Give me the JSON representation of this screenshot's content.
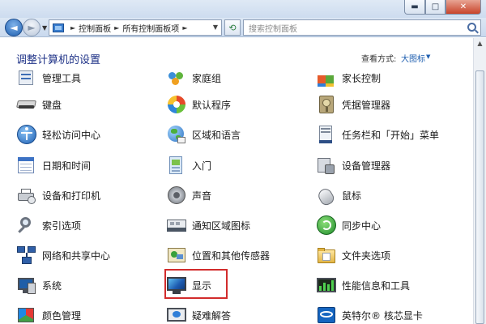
{
  "window": {
    "minimize_glyph": "▬",
    "maximize_glyph": "□",
    "close_glyph": "✕"
  },
  "nav": {
    "back_glyph": "◄",
    "forward_glyph": "►",
    "dropdown_glyph": "▼",
    "breadcrumbs": [
      "控制面板",
      "所有控制面板项"
    ],
    "separator": "►",
    "refresh_glyph": "⟲",
    "search_placeholder": "搜索控制面板"
  },
  "header": {
    "title": "调整计算机的设置",
    "view_by_label": "查看方式:",
    "view_by_value": "大图标",
    "view_caret": "▼"
  },
  "items": {
    "admin_tools": "管理工具",
    "homegroup": "家庭组",
    "parental": "家长控制",
    "keyboard": "键盘",
    "default_programs": "默认程序",
    "credential_manager": "凭据管理器",
    "ease_of_access": "轻松访问中心",
    "region_language": "区域和语言",
    "taskbar_start": "任务栏和「开始」菜单",
    "date_time": "日期和时间",
    "getting_started": "入门",
    "device_manager": "设备管理器",
    "devices_printers": "设备和打印机",
    "sound": "声音",
    "mouse": "鼠标",
    "indexing": "索引选项",
    "notification_icons": "通知区域图标",
    "sync_center": "同步中心",
    "network_sharing": "网络和共享中心",
    "location_sensors": "位置和其他传感器",
    "folder_options": "文件夹选项",
    "system": "系统",
    "display": "显示",
    "performance": "性能信息和工具",
    "color_management": "颜色管理",
    "troubleshooting": "疑难解答",
    "intel_graphics": "英特尔® 核芯显卡"
  },
  "scrollbar": {
    "up_glyph": "▲"
  }
}
